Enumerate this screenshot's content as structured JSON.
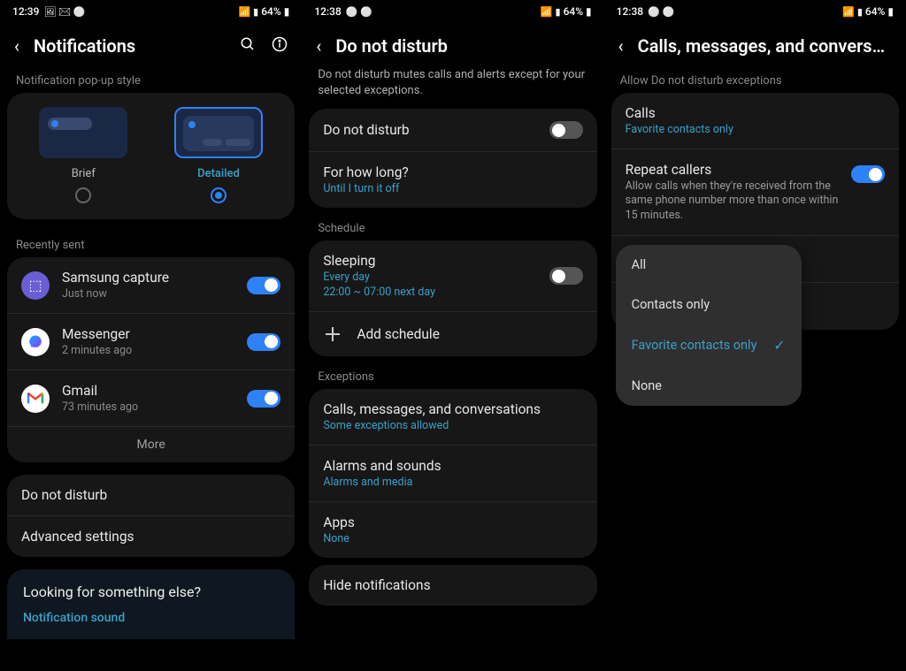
{
  "screen1": {
    "status": {
      "time": "12:39",
      "battery": "64%"
    },
    "header": {
      "title": "Notifications"
    },
    "popup_style_label": "Notification pop-up style",
    "style_brief": "Brief",
    "style_detailed": "Detailed",
    "recently_sent_label": "Recently sent",
    "apps": [
      {
        "name": "Samsung capture",
        "time": "Just now"
      },
      {
        "name": "Messenger",
        "time": "2 minutes ago"
      },
      {
        "name": "Gmail",
        "time": "73 minutes ago"
      }
    ],
    "more": "More",
    "dnd": "Do not disturb",
    "advanced": "Advanced settings",
    "suggest_title": "Looking for something else?",
    "suggest_link": "Notification sound"
  },
  "screen2": {
    "status": {
      "time": "12:38",
      "battery": "64%"
    },
    "header": {
      "title": "Do not disturb"
    },
    "description": "Do not disturb mutes calls and alerts except for your selected exceptions.",
    "dnd_toggle": "Do not disturb",
    "how_long": {
      "title": "For how long?",
      "sub": "Until I turn it off"
    },
    "schedule_label": "Schedule",
    "sleeping": {
      "title": "Sleeping",
      "sub1": "Every day",
      "sub2": "22:00 ~ 07:00 next day"
    },
    "add_schedule": "Add schedule",
    "exceptions_label": "Exceptions",
    "calls_convo": {
      "title": "Calls, messages, and conversations",
      "sub": "Some exceptions allowed"
    },
    "alarms": {
      "title": "Alarms and sounds",
      "sub": "Alarms and media"
    },
    "apps_item": {
      "title": "Apps",
      "sub": "None"
    },
    "hide_notifications": "Hide notifications"
  },
  "screen3": {
    "status": {
      "time": "12:38",
      "battery": "64%"
    },
    "header": {
      "title": "Calls, messages, and conversa…"
    },
    "allow_label": "Allow Do not disturb exceptions",
    "calls": {
      "title": "Calls",
      "sub": "Favorite contacts only"
    },
    "repeat": {
      "title": "Repeat callers",
      "sub": "Allow calls when they're received from the same phone number more than once within 15 minutes."
    },
    "dropdown": {
      "all": "All",
      "contacts": "Contacts only",
      "favorite": "Favorite contacts only",
      "none": "None"
    }
  }
}
